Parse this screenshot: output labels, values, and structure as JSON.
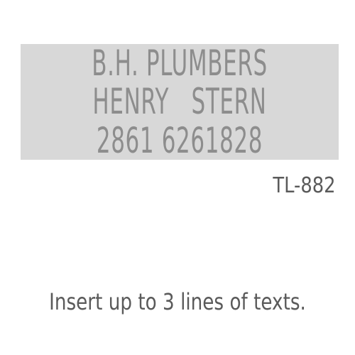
{
  "plate": {
    "lines": [
      "B.H. PLUMBERS",
      "HENRY   STERN",
      "2861 6261828"
    ],
    "colors": {
      "background": "#d8d8d8",
      "text": "#8d8d8d"
    }
  },
  "product": {
    "code": "TL-882"
  },
  "instruction": {
    "text": "Insert up to 3 lines of texts."
  }
}
